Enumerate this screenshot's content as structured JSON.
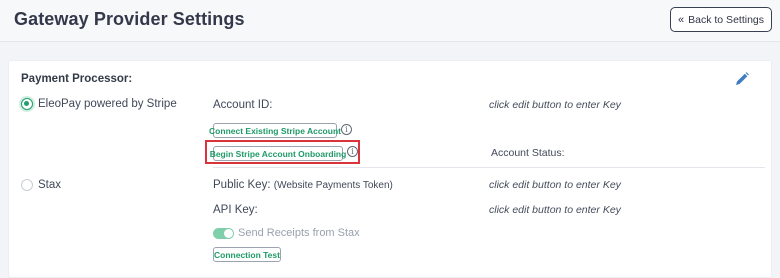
{
  "header": {
    "title": "Gateway Provider Settings",
    "back_label": "Back to Settings",
    "back_icon": "chevron-double-left-icon"
  },
  "section": {
    "label": "Payment Processor:",
    "edit_icon": "pencil-icon",
    "accent_color": "#1f9e6e"
  },
  "options": [
    {
      "label": "EleoPay powered by Stripe",
      "selected": true
    },
    {
      "label": "Stax",
      "selected": false
    }
  ],
  "stripe": {
    "account_id_label": "Account ID:",
    "account_id_hint": "click edit button to enter Key",
    "connect_button": "Connect Existing Stripe Account",
    "onboarding_button": "Begin Stripe Account Onboarding",
    "account_status_label": "Account Status:"
  },
  "stax": {
    "public_key_label": "Public Key:",
    "public_key_sub": "(Website Payments Token)",
    "public_key_hint": "click edit button to enter Key",
    "api_key_label": "API Key:",
    "api_key_hint": "click edit button to enter Key",
    "receipts_toggle_label": "Send Receipts from Stax",
    "receipts_toggle_on": true,
    "connection_test_button": "Connection Test"
  }
}
